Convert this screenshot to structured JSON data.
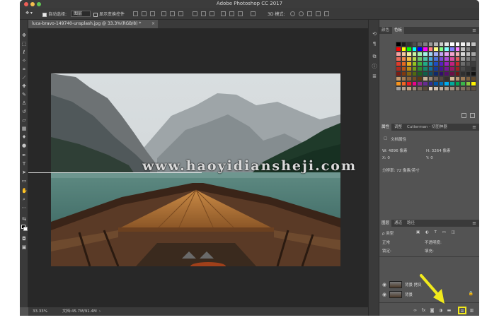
{
  "app": {
    "title": "Adobe Photoshop CC 2017"
  },
  "options_bar": {
    "auto_select_label": "自动选择:",
    "auto_select_value": "图层",
    "show_transform_label": "显示变换控件"
  },
  "document": {
    "tab_label": "luca-bravo-149740-unsplash.jpg @ 33.3%(RGB/8) *",
    "close_glyph": "×"
  },
  "status": {
    "zoom": "33.33%",
    "doc_info": "文档:45.7M/91.4M"
  },
  "swatches_panel": {
    "tabs": [
      "颜色",
      "色板"
    ],
    "active_tab": 1
  },
  "properties_panel": {
    "tabs": [
      "属性",
      "调整",
      "Cutterman - 切图神器"
    ],
    "active_tab": 0,
    "section_label": "文档属性",
    "width_label": "W: 4896 像素",
    "height_label": "H: 3264 像素",
    "x_label": "X: 0",
    "y_label": "Y: 0",
    "resolution_label": "分辨率: 72 像素/英寸"
  },
  "layers_panel": {
    "tabs": [
      "图层",
      "通道",
      "路径"
    ],
    "active_tab": 0,
    "filter_label": "ρ 类型",
    "blend_mode": "正常",
    "opacity_label": "不透明度:",
    "lock_label": "锁定:",
    "fill_label": "填充:",
    "layers": [
      {
        "name": "背景 拷贝",
        "locked": false
      },
      {
        "name": "背景",
        "locked": true
      }
    ]
  },
  "watermark": {
    "text": "www.haoyidiansheji.com"
  },
  "colors": {
    "ui_dark": "#3a3a3a",
    "ui_mid": "#535353",
    "canvas": "#282828",
    "highlight": "#f2ea1c"
  },
  "icons": {
    "menu": "≡",
    "eye": "◉",
    "lock": "🔒"
  }
}
